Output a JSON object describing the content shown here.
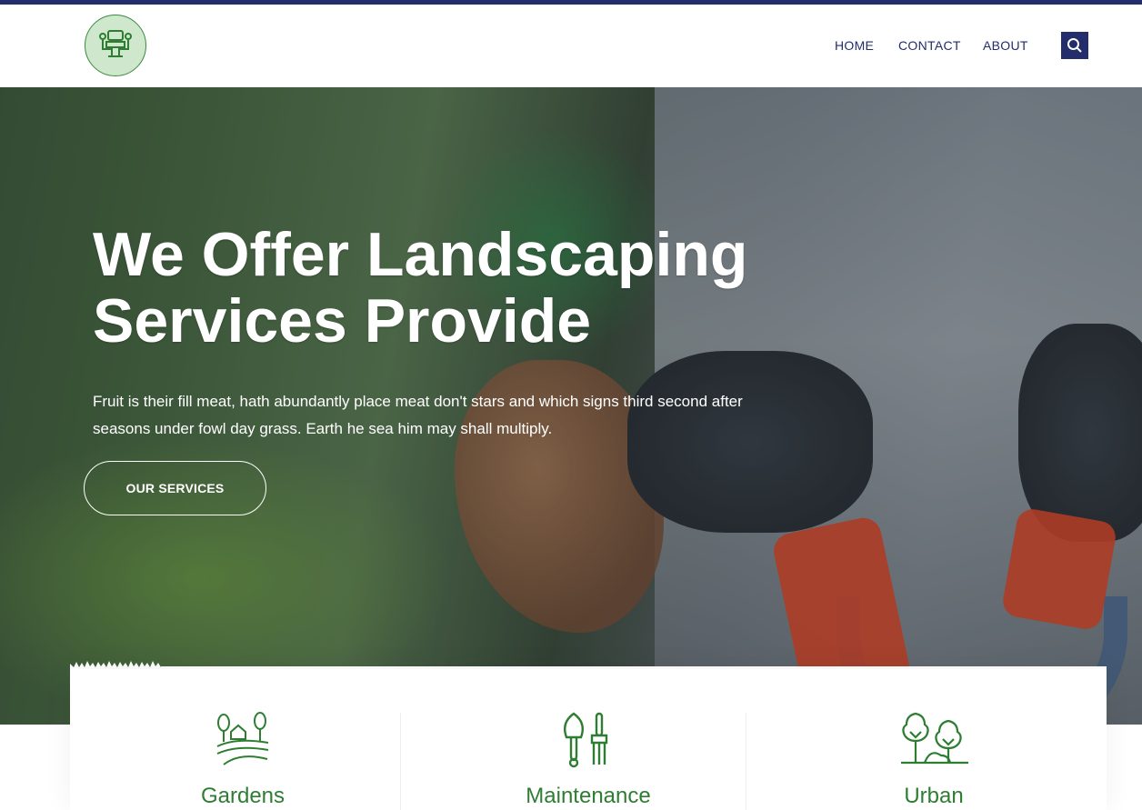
{
  "colors": {
    "navy": "#232d6b",
    "green": "#2e7d32",
    "white": "#ffffff"
  },
  "header": {
    "logo_icon": "people-at-table-icon",
    "nav": [
      {
        "label": "HOME"
      },
      {
        "label": "CONTACT"
      },
      {
        "label": "ABOUT"
      }
    ],
    "search_icon": "search-icon"
  },
  "hero": {
    "title_line1": "We Offer Landscaping",
    "title_line2": "Services Provide",
    "text": "Fruit is their fill meat, hath abundantly place meat don't stars and which signs third second after seasons under fowl day grass. Earth he sea him may shall multiply.",
    "button_label": "OUR SERVICES"
  },
  "services": [
    {
      "label": "Gardens",
      "icon": "farm-field-icon"
    },
    {
      "label": "Maintenance",
      "icon": "shovel-fork-icon"
    },
    {
      "label": "Urban",
      "icon": "trees-icon"
    }
  ]
}
